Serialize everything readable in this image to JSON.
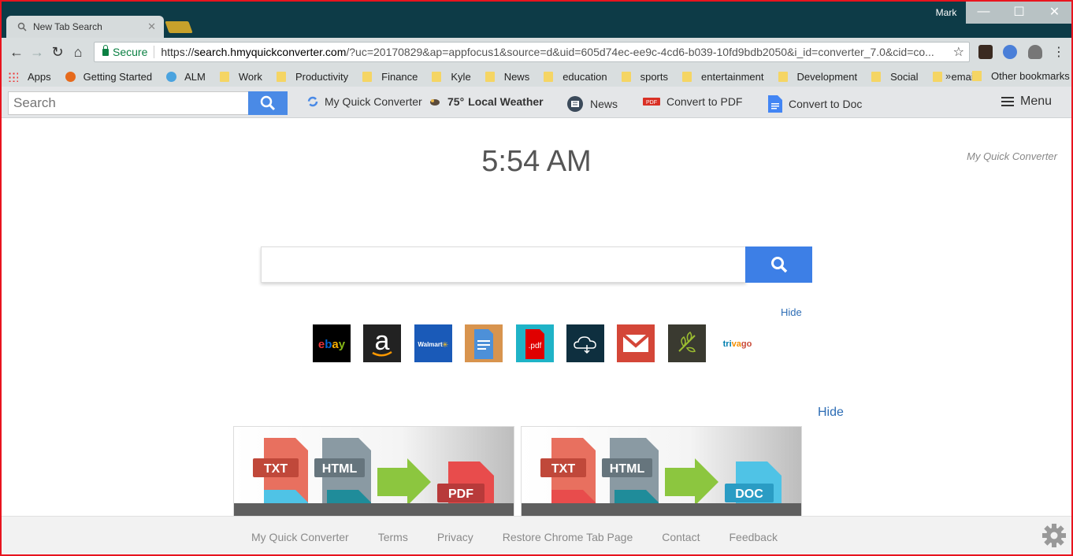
{
  "browser": {
    "tab_title": "New Tab Search",
    "user_name": "Mark",
    "secure_label": "Secure",
    "url_scheme": "https://",
    "url_host": "search.hmyquickconverter.com",
    "url_rest": "/?uc=20170829&ap=appfocus1&source=d&uid=605d74ec-ee9c-4cd6-b039-10fd9bdb2050&i_id=converter_7.0&cid=co..."
  },
  "bookmarks": {
    "items": [
      "Apps",
      "Getting Started",
      "ALM",
      "Work",
      "Productivity",
      "Finance",
      "Kyle",
      "News",
      "education",
      "sports",
      "entertainment",
      "Development",
      "Social",
      "email"
    ],
    "more": "»",
    "other": "Other bookmarks"
  },
  "appbar": {
    "search_placeholder": "Search",
    "nav": {
      "converter": "My Quick Converter",
      "weather_temp": "75°",
      "weather_label": "Local Weather",
      "news": "News",
      "pdf": "Convert to PDF",
      "doc": "Convert to Doc"
    },
    "menu_label": "Menu"
  },
  "main": {
    "time": "5:54 AM",
    "brand": "My Quick Converter",
    "hide_tiles": "Hide",
    "hide_cards": "Hide"
  },
  "tiles": [
    {
      "name": "ebay",
      "label": "ebay"
    },
    {
      "name": "amazon",
      "label": "a"
    },
    {
      "name": "walmart",
      "label": "Walmart"
    },
    {
      "name": "docs",
      "label": ""
    },
    {
      "name": "pdf",
      "label": ".pdf"
    },
    {
      "name": "cloud",
      "label": ""
    },
    {
      "name": "gmail",
      "label": ""
    },
    {
      "name": "ancestry",
      "label": ""
    },
    {
      "name": "trivago",
      "label": "trivago"
    }
  ],
  "cards": [
    {
      "labels": [
        "TXT",
        "HTML"
      ],
      "target": "PDF"
    },
    {
      "labels": [
        "TXT",
        "HTML"
      ],
      "target": "DOC"
    }
  ],
  "footer": {
    "links": [
      "My Quick Converter",
      "Terms",
      "Privacy",
      "Restore Chrome Tab Page",
      "Contact",
      "Feedback"
    ]
  },
  "colors": {
    "accent_blue": "#3d7fe6",
    "title_bar": "#0d3b47",
    "frame_red": "#e8141e"
  }
}
